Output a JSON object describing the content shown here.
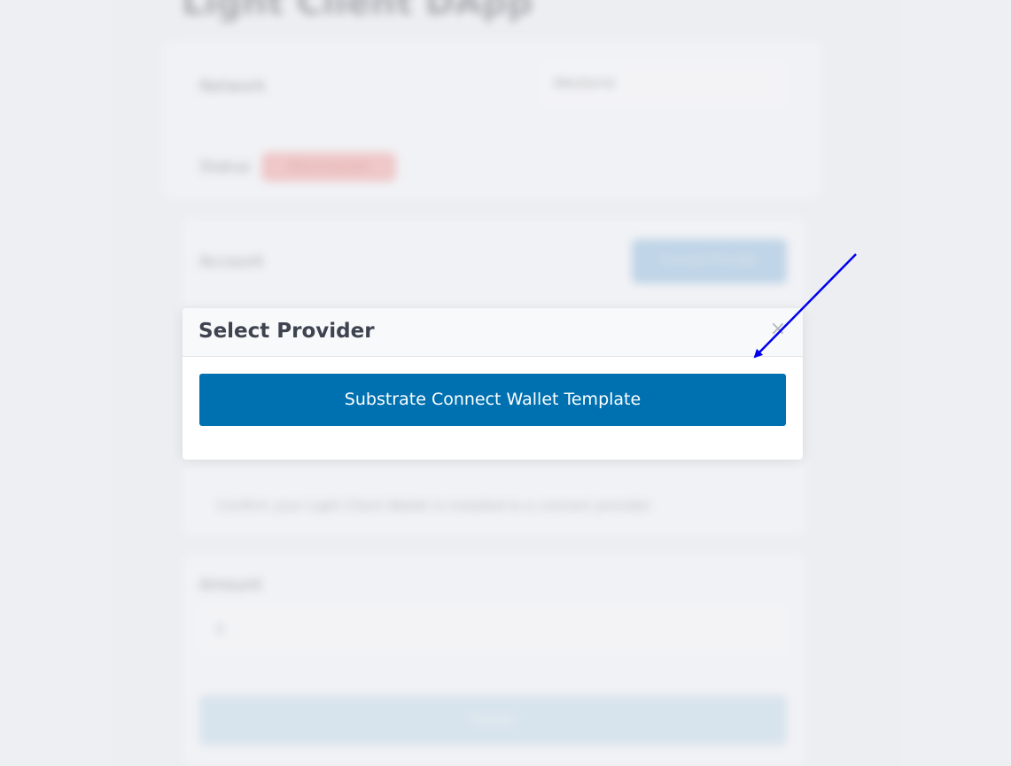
{
  "page": {
    "title": "Light Client DApp"
  },
  "background": {
    "network_label": "Network",
    "network_value": "Westend",
    "status_label": "Status",
    "status_badge": "Disconnected",
    "account_label": "Account",
    "connect_button": "Connect Provider",
    "hint_text": "Confirm your Light Client Wallet is installed to a connect provider",
    "amount_label": "Amount",
    "amount_value": "0",
    "submit_button": "Transfer"
  },
  "modal": {
    "title": "Select Provider",
    "close_glyph": "×",
    "providers": [
      {
        "label": "Substrate Connect Wallet Template"
      }
    ]
  },
  "annotation": {
    "arrow_color": "#0000ee"
  },
  "colors": {
    "primary": "#0071b0",
    "modal_header_bg": "#f8f9fa",
    "page_bg": "#eceef2"
  }
}
